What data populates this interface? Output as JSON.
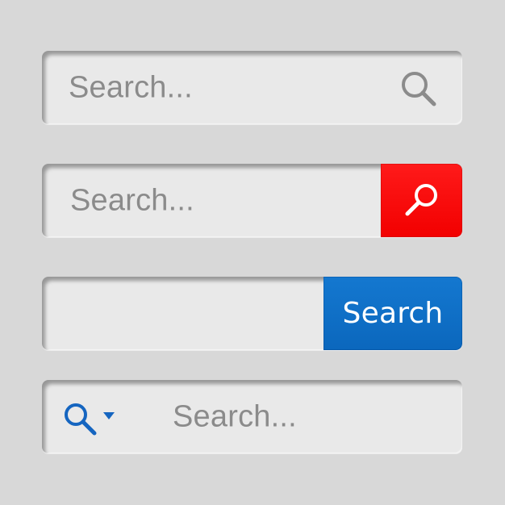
{
  "search_bars": [
    {
      "placeholder": "Search...",
      "icon": "search-icon"
    },
    {
      "placeholder": "Search...",
      "button_icon": "search-icon",
      "button_color": "#ff0000"
    },
    {
      "input_value": "",
      "button_label": "Search",
      "button_color": "#0d6cc4"
    },
    {
      "leading_icon": "search-icon",
      "dropdown_icon": "caret-down-icon",
      "placeholder": "Search...",
      "icon_color": "#1565c0"
    }
  ],
  "colors": {
    "background": "#d8d8d8",
    "field": "#e9e9e9",
    "placeholder_text": "#8b8b8b",
    "plain_icon": "#8b8b8b"
  }
}
